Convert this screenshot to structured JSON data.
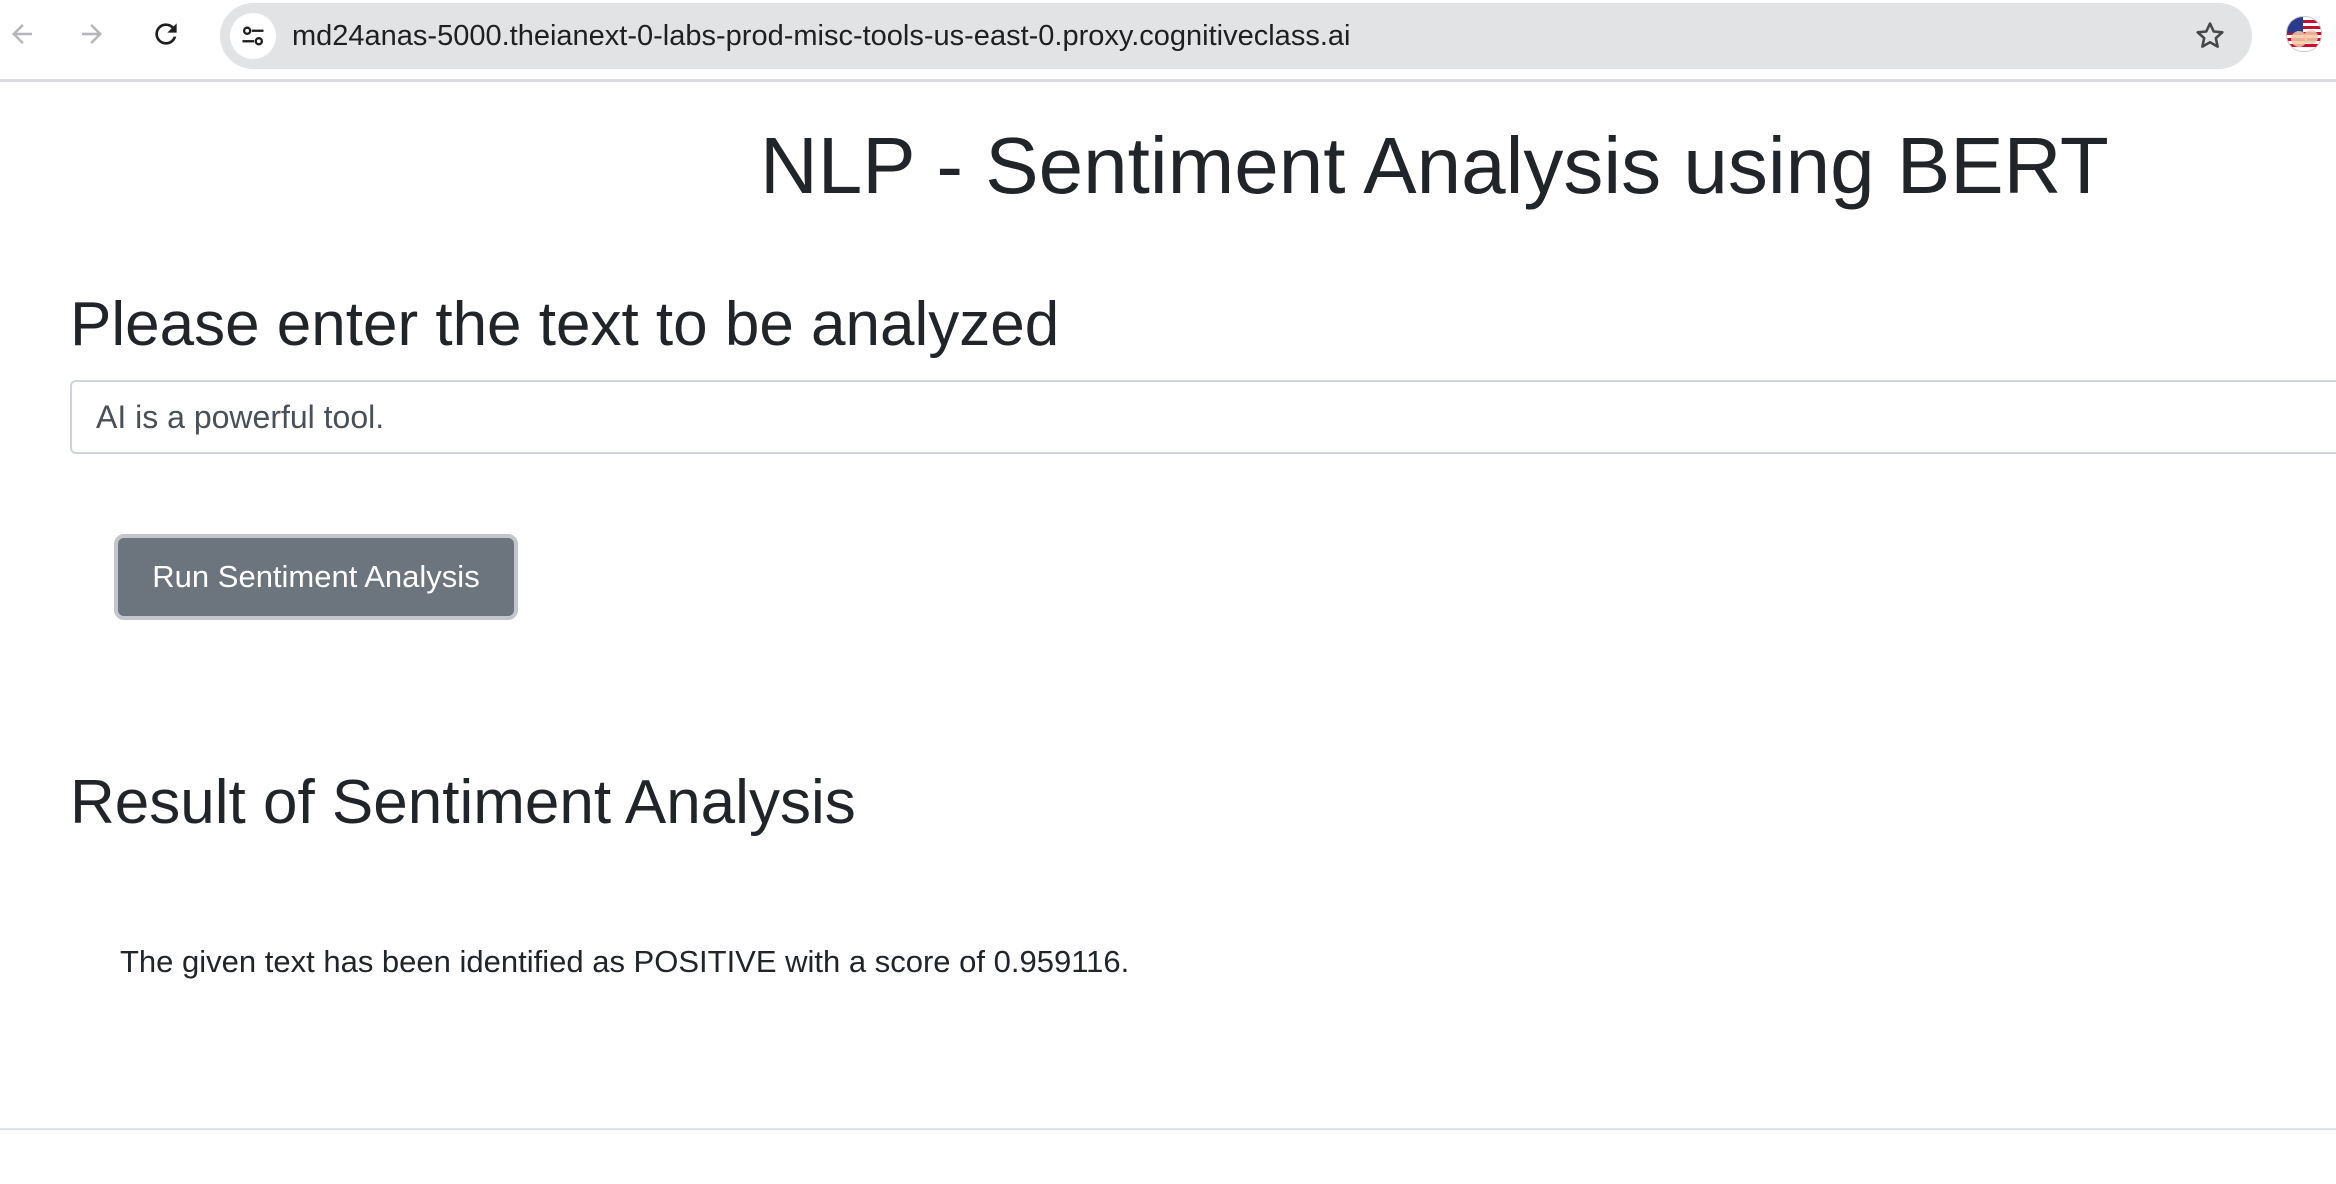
{
  "browser": {
    "url": "md24anas-5000.theianext-0-labs-prod-misc-tools-us-east-0.proxy.cognitiveclass.ai",
    "icons": {
      "back": "arrow-left-icon",
      "forward": "arrow-right-icon",
      "reload": "reload-icon",
      "site_info": "tune-icon",
      "bookmark": "star-icon",
      "profile": "profile-avatar"
    }
  },
  "page": {
    "title": "NLP - Sentiment Analysis using BERT",
    "input_heading": "Please enter the text to be analyzed",
    "input_value": "AI is a powerful tool.",
    "run_button_label": "Run Sentiment Analysis",
    "result_heading": "Result of Sentiment Analysis",
    "result_text": "The given text has been identified as POSITIVE with a score of 0.959116."
  },
  "colors": {
    "button_bg": "#6c757d",
    "text": "#212529",
    "omnibox_bg": "#e2e3e5"
  }
}
